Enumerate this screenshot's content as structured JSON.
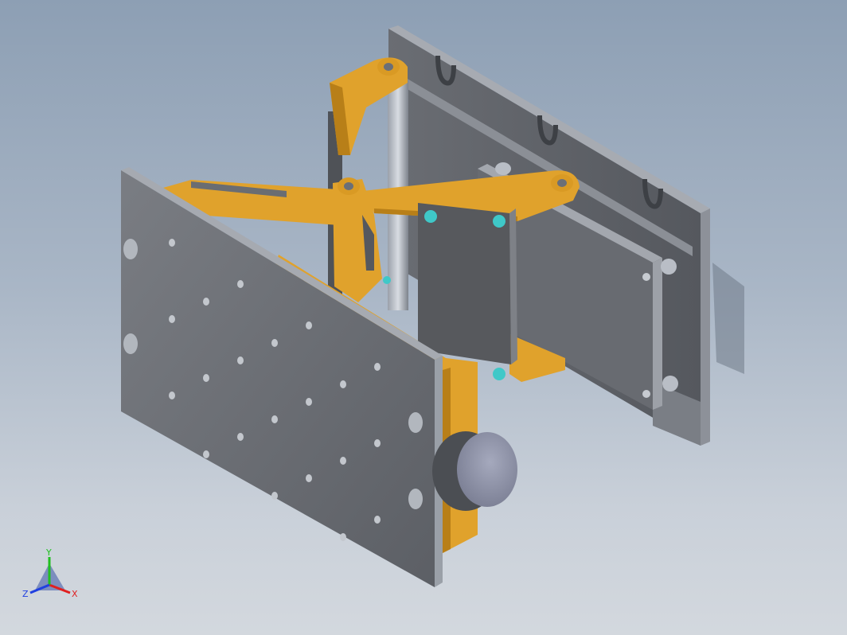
{
  "viewport": {
    "background_top": "#8d9fb4",
    "background_bottom": "#d3d8de"
  },
  "model": {
    "parts": [
      "mounting-plate",
      "slotted-back-plate",
      "scissor-arms",
      "pivot-pins",
      "pad-cylinder",
      "clamp-plate",
      "support-rods"
    ],
    "colors": {
      "steel_face": "#6f7278",
      "steel_edge": "#9ea3ab",
      "steel_dark": "#4a4d52",
      "arm_gold": "#e0a22c",
      "arm_gold_dark": "#b87f18",
      "screw_cyan": "#3fc8c8",
      "pad_face": "#8f93a8"
    }
  },
  "triad": {
    "x_label": "X",
    "y_label": "Y",
    "z_label": "Z",
    "x_color": "#e02020",
    "y_color": "#20c020",
    "z_color": "#2040e0"
  }
}
